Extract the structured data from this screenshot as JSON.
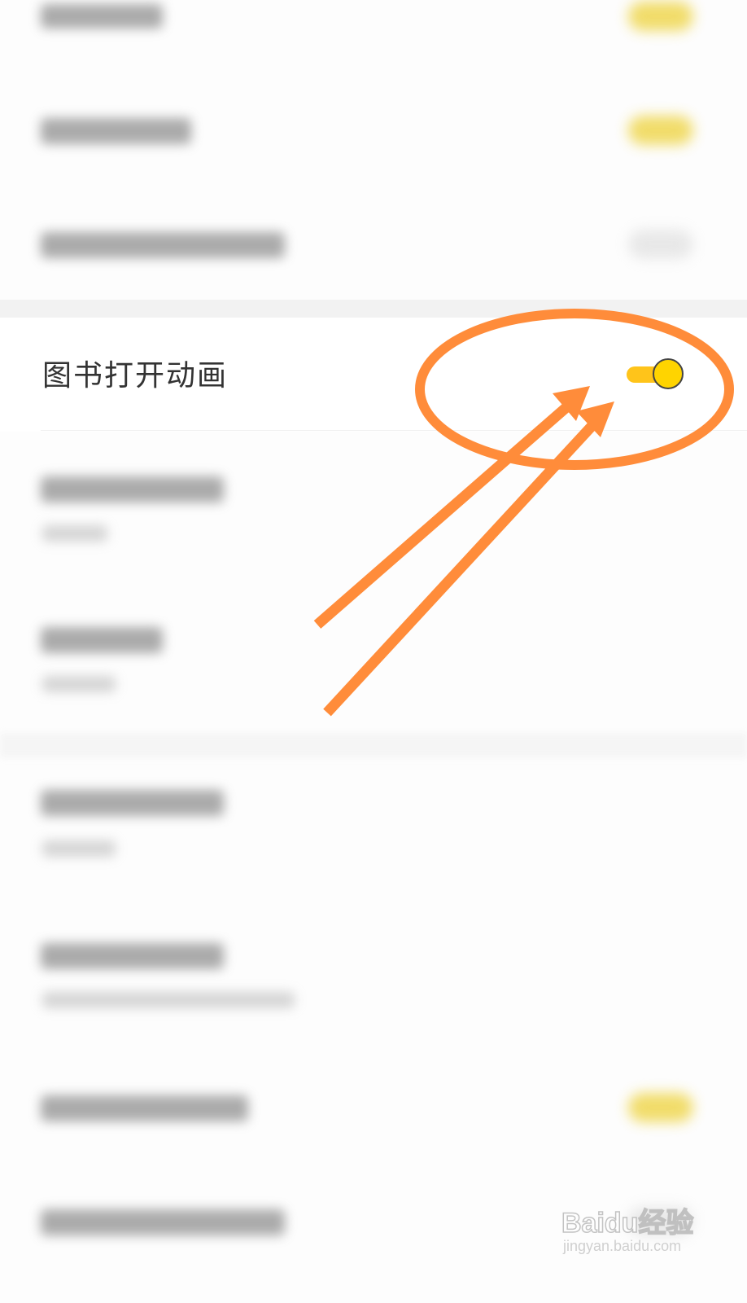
{
  "settings": {
    "book_open_animation": {
      "label": "图书打开动画",
      "enabled": true
    }
  },
  "colors": {
    "toggle_on_track": "#ffc41a",
    "toggle_on_knob": "#ffd400",
    "annotation": "#ff8c3a"
  },
  "annotation": {
    "shape": "ellipse-with-two-arrows",
    "target": "book_open_animation toggle"
  },
  "watermark": {
    "brand": "Baidu经验",
    "url": "jingyan.baidu.com"
  }
}
